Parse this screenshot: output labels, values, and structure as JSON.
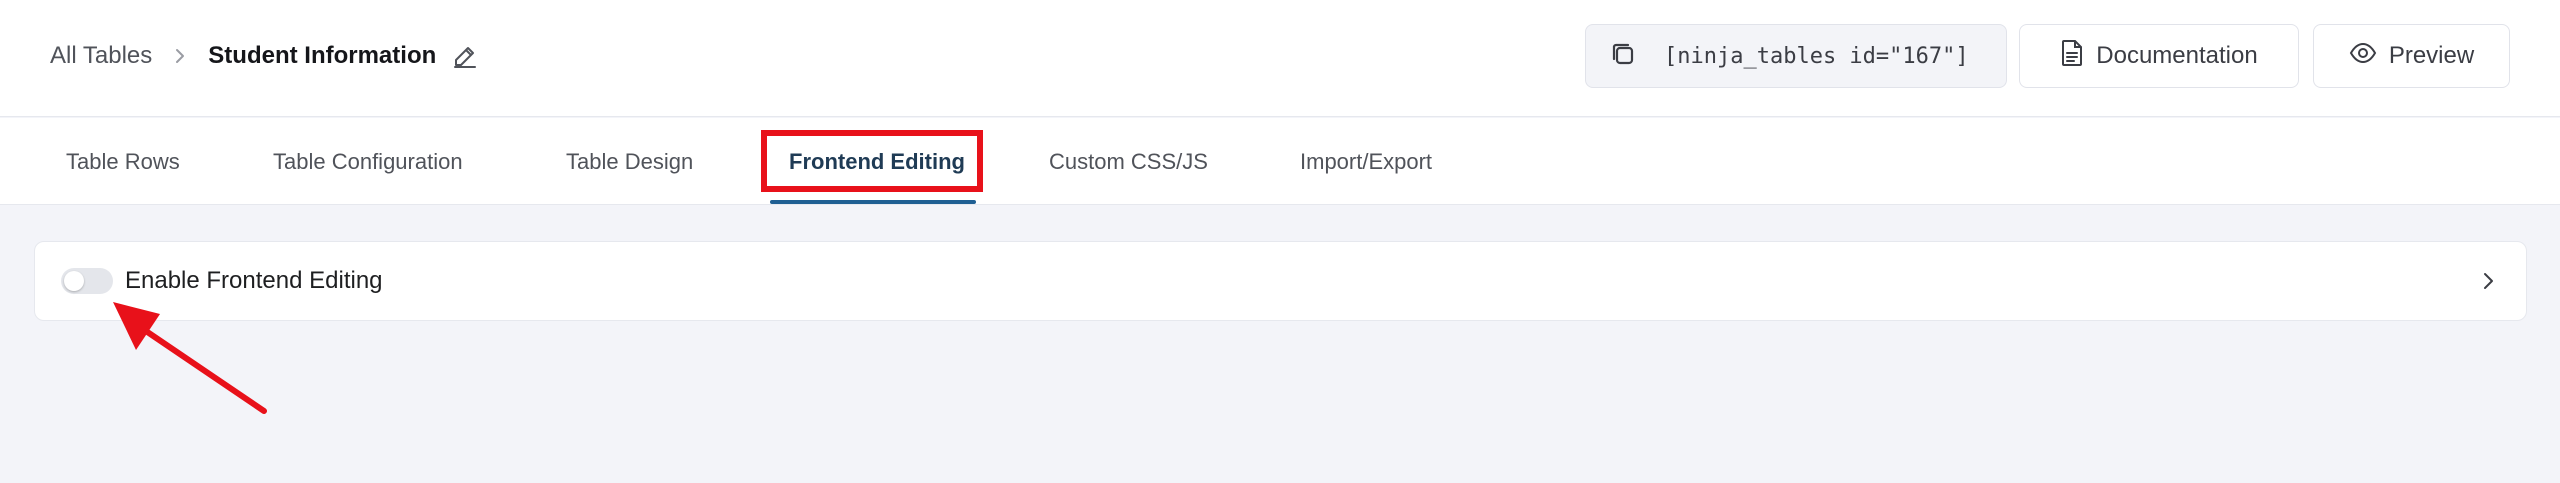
{
  "header": {
    "breadcrumb_root": "All Tables",
    "breadcrumb_current": "Student Information",
    "shortcode": "[ninja_tables id=\"167\"]",
    "documentation_label": "Documentation",
    "preview_label": "Preview"
  },
  "tabs": [
    {
      "label": "Table Rows",
      "active": false
    },
    {
      "label": "Table Configuration",
      "active": false
    },
    {
      "label": "Table Design",
      "active": false
    },
    {
      "label": "Frontend Editing",
      "active": true
    },
    {
      "label": "Custom CSS/JS",
      "active": false
    },
    {
      "label": "Import/Export",
      "active": false
    }
  ],
  "panel": {
    "toggle_label": "Enable Frontend Editing",
    "toggle_on": false
  },
  "icons": {
    "edit": "pencil-icon",
    "copy": "copy-icon",
    "documentation": "document-icon",
    "preview": "eye-icon",
    "breadcrumb_separator": "chevron-right-icon",
    "expand": "chevron-right-icon"
  },
  "colors": {
    "highlight": "#e8111a",
    "active_tab_underline": "#1f5f93",
    "active_tab_text": "#1f3b55",
    "page_background": "#f3f4f9"
  }
}
